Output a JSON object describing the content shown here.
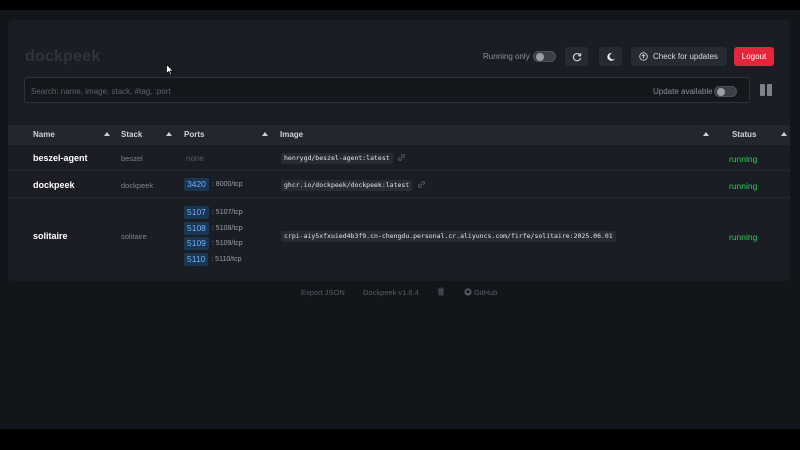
{
  "app": {
    "logo": "dockpeek"
  },
  "toolbar": {
    "running_only_label": "Running only",
    "refresh_icon": "refresh-icon",
    "theme_icon": "moon-icon",
    "check_updates_label": "Check for updates",
    "logout_label": "Logout",
    "logout_color": "#e5263a"
  },
  "search": {
    "placeholder": "Search: name, image, stack, #tag, :port",
    "value": "",
    "update_available_label": "Update available"
  },
  "table": {
    "headers": [
      "Name",
      "Stack",
      "Ports",
      "Image",
      "Status"
    ],
    "rows": [
      {
        "name": "beszel-agent",
        "stack": "beszel",
        "ports_none": "none",
        "ports": [],
        "image": "henrygd/beszel-agent:latest",
        "status": "running"
      },
      {
        "name": "dockpeek",
        "stack": "dockpeek",
        "ports": [
          {
            "port": "3420",
            "mapping": ": 8000/tcp"
          }
        ],
        "image": "ghcr.io/dockpeek/dockpeek:latest",
        "status": "running"
      },
      {
        "name": "solitaire",
        "stack": "solitaire",
        "ports": [
          {
            "port": "5107",
            "mapping": ": 5107/tcp"
          },
          {
            "port": "5108",
            "mapping": ": 5108/tcp"
          },
          {
            "port": "5109",
            "mapping": ": 5109/tcp"
          },
          {
            "port": "5110",
            "mapping": ": 5110/tcp"
          }
        ],
        "image": "crpi-aiy5xfxuied4b3f9.cn-chengdu.personal.cr.aliyuncs.com/firfe/solitaire:2025.06.01",
        "status": "running"
      }
    ],
    "status_color": "#34c759",
    "port_color": "#6fb0ff"
  },
  "footer": {
    "export_label": "Export JSON",
    "version": "Dockpeek v1.6.4",
    "github_label": "GitHub"
  }
}
